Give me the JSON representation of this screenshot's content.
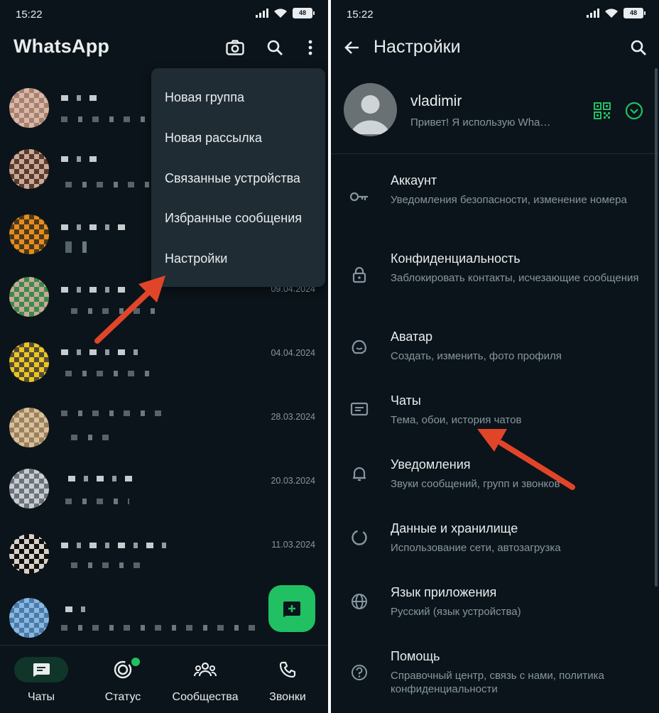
{
  "left": {
    "status_time": "15:22",
    "battery": "48",
    "app_title": "WhatsApp",
    "icons": [
      "camera-icon",
      "search-icon",
      "more-vert-icon"
    ],
    "menu_items": [
      "Новая группа",
      "Новая рассылка",
      "Связанные устройства",
      "Избранные сообщения",
      "Настройки"
    ],
    "chat_dates": [
      "09.04.2024",
      "04.04.2024",
      "28.03.2024",
      "20.03.2024",
      "11.03.2024"
    ],
    "nav": [
      {
        "label": "Чаты",
        "icon": "chat-icon",
        "active": true
      },
      {
        "label": "Статус",
        "icon": "status-icon",
        "active": false
      },
      {
        "label": "Сообщества",
        "icon": "communities-icon",
        "active": false
      },
      {
        "label": "Звонки",
        "icon": "phone-icon",
        "active": false
      }
    ],
    "accent": "#21c063"
  },
  "right": {
    "status_time": "15:22",
    "battery": "48",
    "page_title": "Настройки",
    "profile": {
      "name": "vladimir",
      "status": "Привет! Я использую Wha…"
    },
    "settings": [
      {
        "title": "Аккаунт",
        "subtitle": "Уведомления безопасности, изменение номера",
        "icon": "key-icon"
      },
      {
        "title": "Конфиденциальность",
        "subtitle": "Заблокировать контакты, исчезающие сообщения",
        "icon": "lock-icon"
      },
      {
        "title": "Аватар",
        "subtitle": "Создать, изменить, фото профиля",
        "icon": "avatar-icon"
      },
      {
        "title": "Чаты",
        "subtitle": "Тема, обои, история чатов",
        "icon": "chat-settings-icon"
      },
      {
        "title": "Уведомления",
        "subtitle": "Звуки сообщений, групп и звонков",
        "icon": "bell-icon"
      },
      {
        "title": "Данные и хранилище",
        "subtitle": "Использование сети, автозагрузка",
        "icon": "storage-icon"
      },
      {
        "title": "Язык приложения",
        "subtitle": "Русский (язык устройства)",
        "icon": "globe-icon"
      },
      {
        "title": "Помощь",
        "subtitle": "Справочный центр, связь с нами, политика конфиденциальности",
        "icon": "help-icon"
      }
    ],
    "accent": "#21c063"
  }
}
